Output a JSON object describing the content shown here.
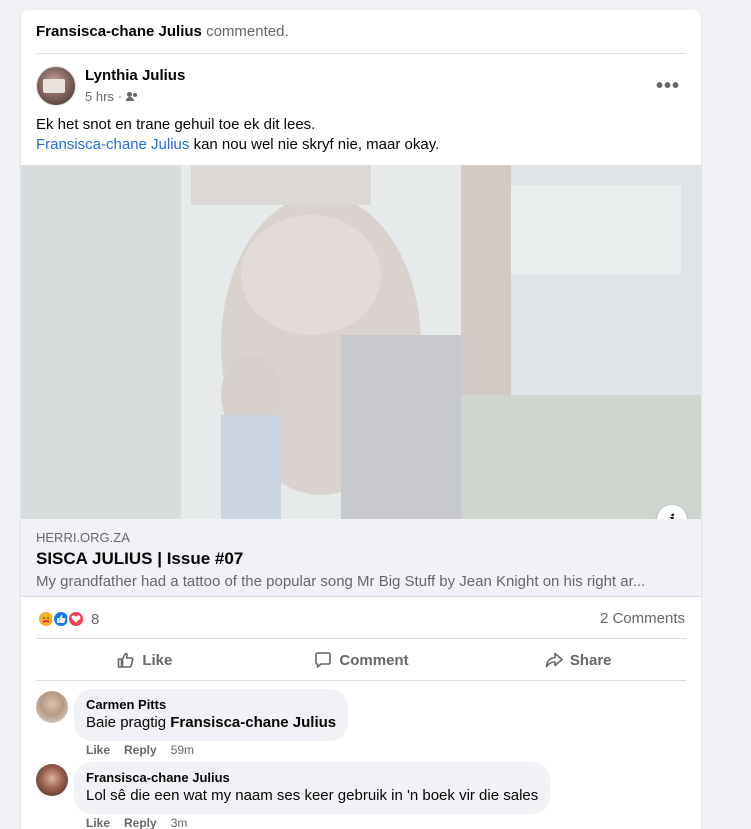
{
  "story": {
    "actor": "Fransisca-chane Julius",
    "verb": "commented."
  },
  "post": {
    "author": "Lynthia Julius",
    "time": "5 hrs",
    "separator": "·",
    "audience_icon": "friends-icon",
    "more_label": "•••",
    "text_line1": "Ek het snot en trane gehuil toe ek dit lees.",
    "mention": "Fransisca-chane Julius",
    "text_line2_rest": " kan nou wel nie skryf nie, maar okay."
  },
  "link": {
    "domain": "HERRI.ORG.ZA",
    "title": "SISCA JULIUS | Issue #07",
    "description": "My grandfather had a tattoo of the popular song Mr Big Stuff by Jean Knight on his right ar...",
    "info_label": "i"
  },
  "engagement": {
    "reaction_icons": [
      "care-icon",
      "like-icon",
      "love-icon"
    ],
    "reaction_count": "8",
    "comments_count": "2 Comments"
  },
  "actions": {
    "like": "Like",
    "comment": "Comment",
    "share": "Share"
  },
  "comments": [
    {
      "author": "Carmen Pitts",
      "text_prefix": "Baie pragtig ",
      "tag": "Fransisca-chane Julius",
      "like": "Like",
      "reply": "Reply",
      "time": "59m"
    },
    {
      "author": "Fransisca-chane Julius",
      "text": "Lol sê die een wat my naam ses keer gebruik in 'n boek vir die sales",
      "like": "Like",
      "reply": "Reply",
      "time": "3m"
    }
  ],
  "colors": {
    "link_blue": "#216fdb",
    "secondary_text": "#65676b",
    "like_blue": "#1877f2",
    "love_red": "#f33e58",
    "care_yellow": "#f7b125"
  }
}
